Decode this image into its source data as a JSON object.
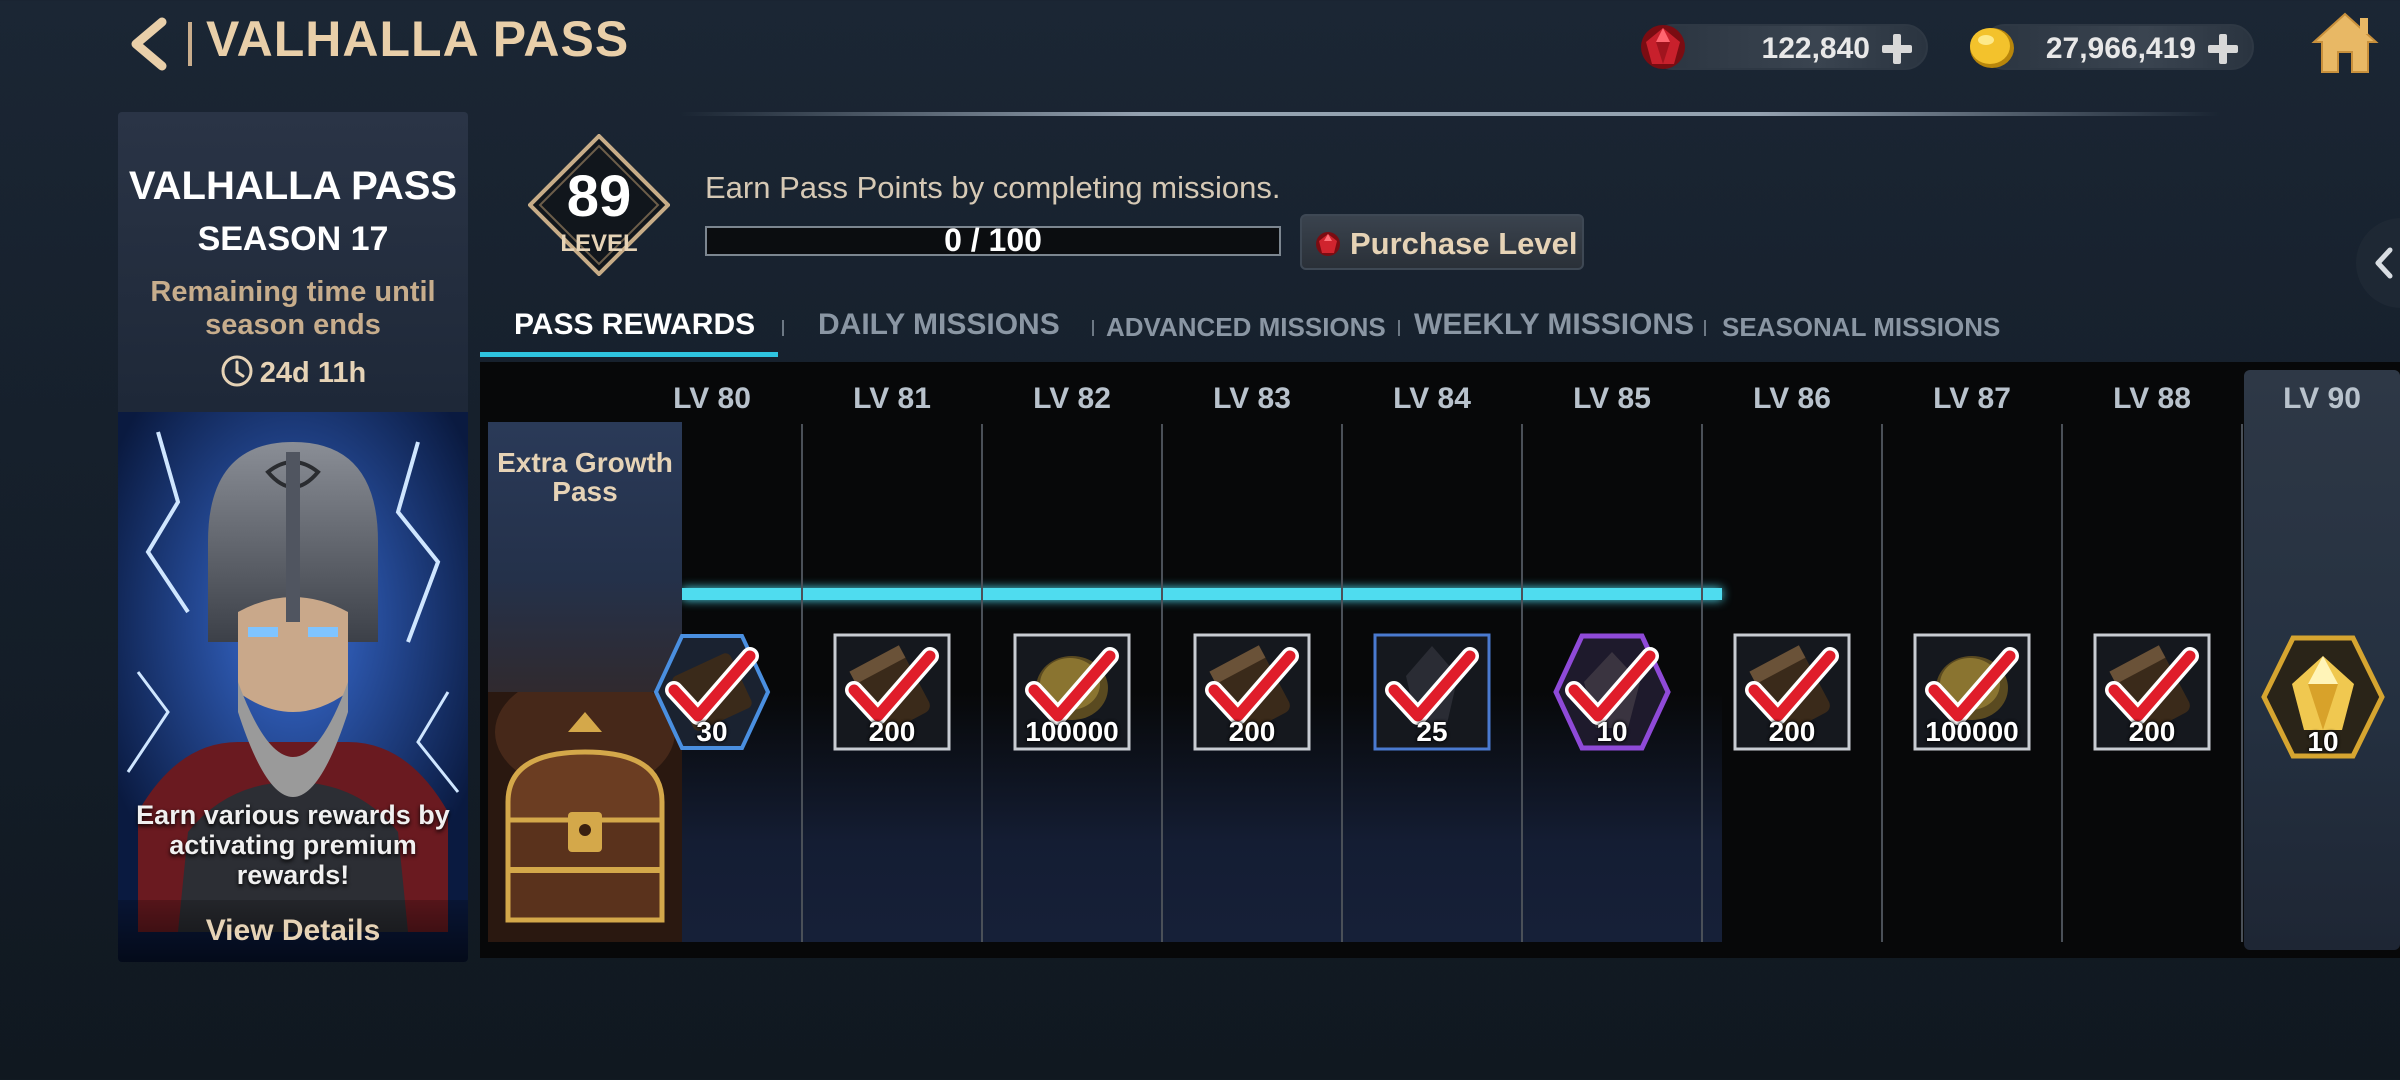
{
  "header": {
    "title": "VALHALLA PASS",
    "gems": "122,840",
    "gold": "27,966,419"
  },
  "left_panel": {
    "title": "VALHALLA PASS",
    "season": "SEASON 17",
    "remaining_label": "Remaining time until season ends",
    "remaining_time": "24d 11h",
    "earn_text": "Earn various rewards by activating premium rewards!",
    "details_label": "View Details"
  },
  "level": {
    "value": "89",
    "label": "LEVEL"
  },
  "progress": {
    "description": "Earn Pass Points by completing missions.",
    "text": "0 / 100",
    "fraction": 0.0,
    "purchase_label": "Purchase Level"
  },
  "tabs": [
    {
      "label": "PASS REWARDS",
      "active": true
    },
    {
      "label": "DAILY MISSIONS",
      "active": false
    },
    {
      "label": "ADVANCED MISSIONS",
      "active": false
    },
    {
      "label": "WEEKLY MISSIONS",
      "active": false
    },
    {
      "label": "SEASONAL MISSIONS",
      "active": false
    }
  ],
  "track": {
    "extra_label": "Extra Growth Pass",
    "levels": [
      {
        "label": "LV 80",
        "amount": "30",
        "icon": "hex-scroll-icon",
        "claimed": true
      },
      {
        "label": "LV 81",
        "amount": "200",
        "icon": "scroll-icon",
        "claimed": true
      },
      {
        "label": "LV 82",
        "amount": "100000",
        "icon": "gold-coin-icon",
        "claimed": true
      },
      {
        "label": "LV 83",
        "amount": "200",
        "icon": "scroll-icon",
        "claimed": true
      },
      {
        "label": "LV 84",
        "amount": "25",
        "icon": "crystal-icon",
        "claimed": true
      },
      {
        "label": "LV 85",
        "amount": "10",
        "icon": "hex-crystal-icon",
        "claimed": true
      },
      {
        "label": "LV 86",
        "amount": "200",
        "icon": "scroll-icon",
        "claimed": true
      },
      {
        "label": "LV 87",
        "amount": "100000",
        "icon": "gold-coin-icon",
        "claimed": true
      },
      {
        "label": "LV 88",
        "amount": "200",
        "icon": "scroll-icon",
        "claimed": true
      }
    ],
    "special": {
      "label": "LV 90",
      "amount": "10",
      "icon": "gold-gem-icon"
    }
  },
  "colors": {
    "accent_cyan": "#2ec3df",
    "gold_text": "#e9cfa9",
    "check_red": "#e01d2a"
  }
}
